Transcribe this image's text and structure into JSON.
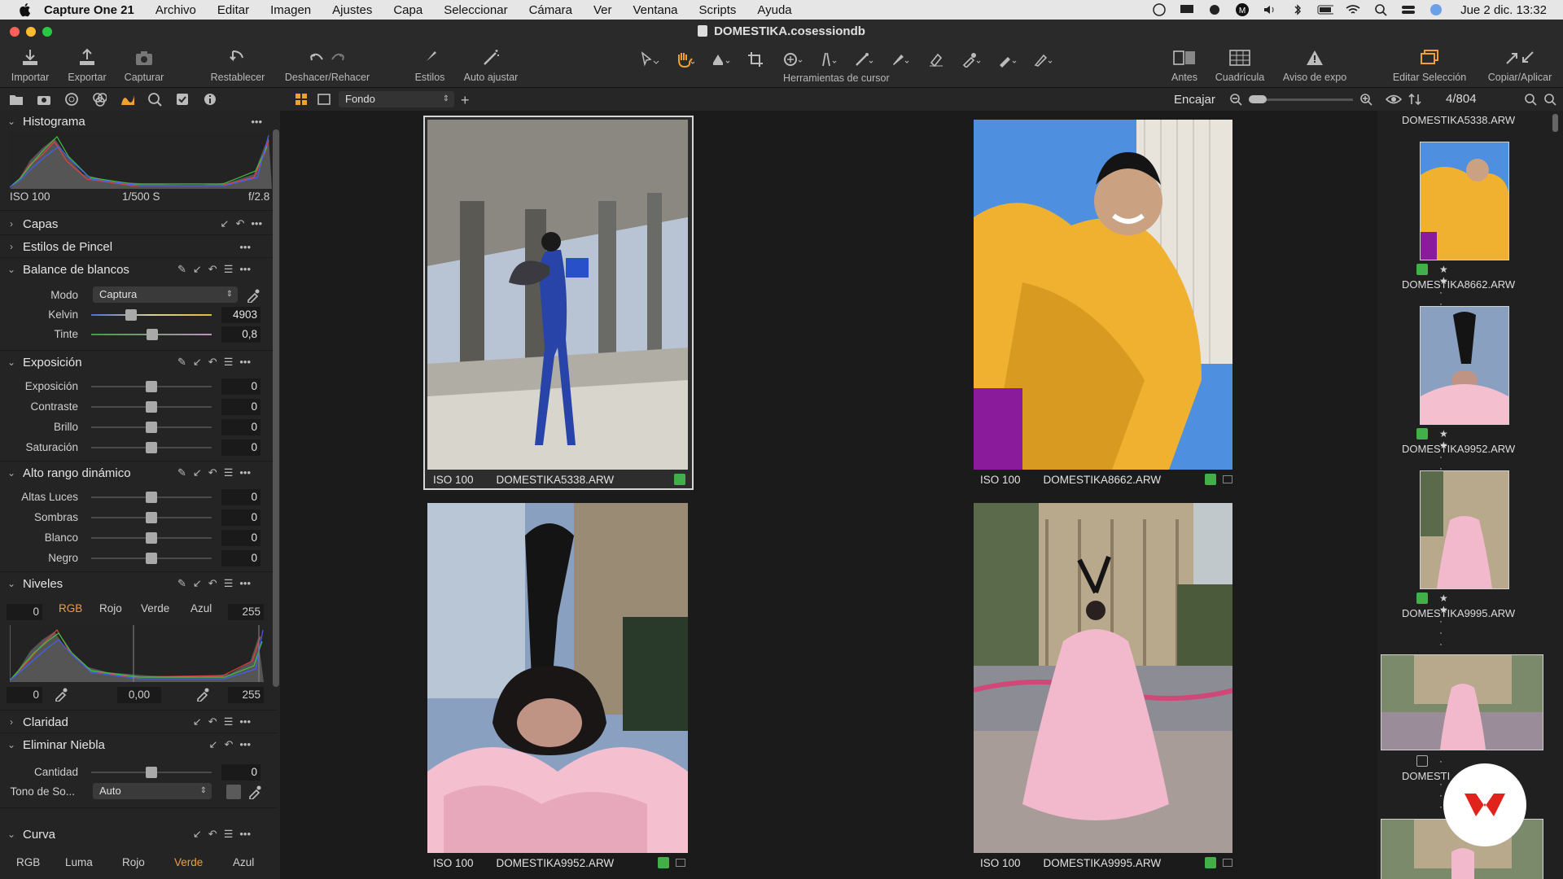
{
  "menubar": {
    "app": "Capture One 21",
    "items": [
      "Archivo",
      "Editar",
      "Imagen",
      "Ajustes",
      "Capa",
      "Seleccionar",
      "Cámara",
      "Ver",
      "Ventana",
      "Scripts",
      "Ayuda"
    ],
    "clock": "Jue 2 dic.  13:32"
  },
  "window": {
    "title": "DOMESTIKA.cosessiondb"
  },
  "toolbar": {
    "importar": "Importar",
    "exportar": "Exportar",
    "capturar": "Capturar",
    "restablecer": "Restablecer",
    "deshacer": "Deshacer/Rehacer",
    "estilos": "Estilos",
    "auto": "Auto ajustar",
    "cursor_tools": "Herramientas de cursor",
    "antes": "Antes",
    "cuadricula": "Cuadrícula",
    "aviso": "Aviso de expo",
    "editar_sel": "Editar Selección",
    "copiar": "Copiar/Aplicar"
  },
  "viewrow": {
    "mode_value": "Fondo",
    "fit": "Encajar",
    "count": "4/804",
    "browser_top_name": "DOMESTIKA5338.ARW"
  },
  "histogram": {
    "title": "Histograma",
    "iso": "ISO 100",
    "shutter": "1/500 S",
    "aperture": "f/2.8"
  },
  "sections": {
    "capas": "Capas",
    "pincel": "Estilos de Pincel",
    "balance": "Balance de blancos",
    "exposicion": "Exposición",
    "hdr": "Alto rango dinámico",
    "niveles": "Niveles",
    "claridad": "Claridad",
    "niebla": "Eliminar Niebla",
    "curva": "Curva"
  },
  "white_balance": {
    "mode_label": "Modo",
    "mode_value": "Captura",
    "kelvin_label": "Kelvin",
    "kelvin_value": "4903",
    "tint_label": "Tinte",
    "tint_value": "0,8"
  },
  "exposure": [
    {
      "label": "Exposición",
      "value": "0"
    },
    {
      "label": "Contraste",
      "value": "0"
    },
    {
      "label": "Brillo",
      "value": "0"
    },
    {
      "label": "Saturación",
      "value": "0"
    }
  ],
  "hdr": [
    {
      "label": "Altas Luces",
      "value": "0"
    },
    {
      "label": "Sombras",
      "value": "0"
    },
    {
      "label": "Blanco",
      "value": "0"
    },
    {
      "label": "Negro",
      "value": "0"
    }
  ],
  "levels": {
    "in_low": "0",
    "in_high": "255",
    "channels": [
      "RGB",
      "Rojo",
      "Verde",
      "Azul"
    ],
    "active_channel": "RGB",
    "out_low": "0",
    "mid": "0,00",
    "out_high": "255"
  },
  "dehaze": {
    "amount_label": "Cantidad",
    "amount_value": "0",
    "tone_label": "Tono de So...",
    "tone_value": "Auto"
  },
  "curve": {
    "channels": [
      "RGB",
      "Luma",
      "Rojo",
      "Verde",
      "Azul"
    ],
    "active_channel": "Verde"
  },
  "viewer": [
    {
      "iso": "ISO 100",
      "name": "DOMESTIKA5338.ARW"
    },
    {
      "iso": "ISO 100",
      "name": "DOMESTIKA8662.ARW"
    },
    {
      "iso": "ISO 100",
      "name": "DOMESTIKA9952.ARW"
    },
    {
      "iso": "ISO 100",
      "name": "DOMESTIKA9995.ARW"
    }
  ],
  "browser": [
    {
      "name": "DOMESTIKA8662.ARW"
    },
    {
      "name": "DOMESTIKA9952.ARW"
    },
    {
      "name": "DOMESTIKA9995.ARW"
    },
    {
      "name": "DOMESTI"
    }
  ],
  "colors": {
    "accent": "#f0a030",
    "green_tag": "#42b04a",
    "panel_bg": "#242424"
  }
}
